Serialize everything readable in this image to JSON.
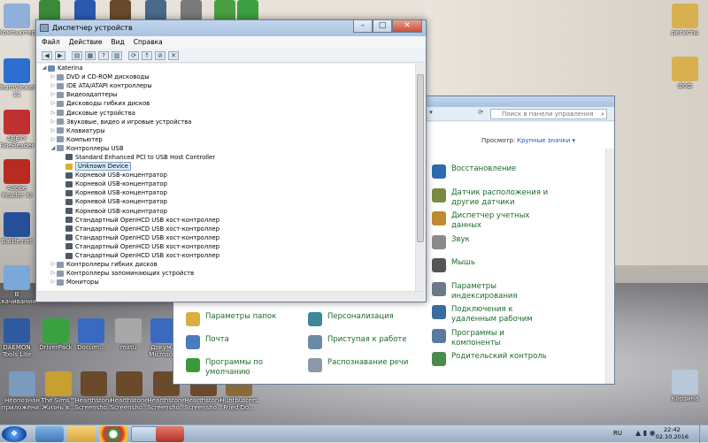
{
  "desktop": {
    "left_icons": [
      {
        "label": "Компьютер"
      },
      {
        "label": "TeamViewer 11"
      },
      {
        "label": "ABBYY FineReader"
      },
      {
        "label": "Adobe Reader XI"
      },
      {
        "label": "Battle.net"
      },
      {
        "label": "В скачивания"
      },
      {
        "label": "DAEMON Tools Lite"
      },
      {
        "label": "DriverPack"
      },
      {
        "label": "Docum..."
      },
      {
        "label": "matu"
      },
      {
        "label": "Докум... Microso..."
      }
    ],
    "bottom_icons": [
      {
        "label": "Неопознан приложени..."
      },
      {
        "label": "The Sims™ Жизнь в..."
      },
      {
        "label": "Hearthstone Screensho..."
      },
      {
        "label": "Hearthstone Screensho..."
      },
      {
        "label": "Hearthstone Screensho..."
      },
      {
        "label": "Hearthstone Screensho..."
      },
      {
        "label": "Huntbusters Fried Do..."
      }
    ],
    "right_icons": [
      {
        "label": "регисты"
      },
      {
        "label": "фоф"
      },
      {
        "label": "Корзина"
      }
    ],
    "top_icons": [
      {
        "label": ""
      },
      {
        "label": ""
      },
      {
        "label": ""
      },
      {
        "label": ""
      },
      {
        "label": ""
      },
      {
        "label": ""
      },
      {
        "label": ""
      }
    ]
  },
  "device_manager": {
    "title": "Диспетчер устройств",
    "menu": [
      "Файл",
      "Действие",
      "Вид",
      "Справка"
    ],
    "tree": [
      {
        "label": "Katerina",
        "level": 0,
        "exp": "◢"
      },
      {
        "label": "DVD и CD-ROM дисководы",
        "level": 1,
        "exp": "▷"
      },
      {
        "label": "IDE ATA/ATAPI контроллеры",
        "level": 1,
        "exp": "▷"
      },
      {
        "label": "Видеоадаптеры",
        "level": 1,
        "exp": "▷"
      },
      {
        "label": "Дисководы гибких дисков",
        "level": 1,
        "exp": "▷"
      },
      {
        "label": "Дисковые устройства",
        "level": 1,
        "exp": "▷"
      },
      {
        "label": "Звуковые, видео и игровые устройства",
        "level": 1,
        "exp": "▷"
      },
      {
        "label": "Клавиатуры",
        "level": 1,
        "exp": "▷"
      },
      {
        "label": "Компьютер",
        "level": 1,
        "exp": "▷"
      },
      {
        "label": "Контроллеры USB",
        "level": 1,
        "exp": "◢"
      },
      {
        "label": "Standard Enhanced PCI to USB Host Controller",
        "level": 2,
        "exp": ""
      },
      {
        "label": "Unknown Device",
        "level": 2,
        "exp": "",
        "selected": true
      },
      {
        "label": "Корневой USB-концентратор",
        "level": 2,
        "exp": ""
      },
      {
        "label": "Корневой USB-концентратор",
        "level": 2,
        "exp": ""
      },
      {
        "label": "Корневой USB-концентратор",
        "level": 2,
        "exp": ""
      },
      {
        "label": "Корневой USB-концентратор",
        "level": 2,
        "exp": ""
      },
      {
        "label": "Корневой USB-концентратор",
        "level": 2,
        "exp": ""
      },
      {
        "label": "Стандартный OpenHCD USB хост-контроллер",
        "level": 2,
        "exp": ""
      },
      {
        "label": "Стандартный OpenHCD USB хост-контроллер",
        "level": 2,
        "exp": ""
      },
      {
        "label": "Стандартный OpenHCD USB хост-контроллер",
        "level": 2,
        "exp": ""
      },
      {
        "label": "Стандартный OpenHCD USB хост-контроллер",
        "level": 2,
        "exp": ""
      },
      {
        "label": "Стандартный OpenHCD USB хост-контроллер",
        "level": 2,
        "exp": ""
      },
      {
        "label": "Контроллеры гибких дисков",
        "level": 1,
        "exp": "▷"
      },
      {
        "label": "Контроллеры запоминающих устройств",
        "level": 1,
        "exp": "▷"
      },
      {
        "label": "Мониторы",
        "level": 1,
        "exp": "▷"
      }
    ]
  },
  "control_panel": {
    "search_placeholder": "Поиск в панели управления",
    "view_label": "Просмотр:",
    "view_value": "Крупные значки",
    "right_items": [
      {
        "label": "Восстановление",
        "color": "#2f6ab0"
      },
      {
        "label": "Датчик расположения и другие датчики",
        "color": "#7a8a40"
      },
      {
        "label": "Диспетчер учетных данных",
        "color": "#c08a30"
      },
      {
        "label": "Звук",
        "color": "#8a8a8a"
      },
      {
        "label": "Мышь",
        "color": "#555555"
      },
      {
        "label": "Параметры индексирования",
        "color": "#6a7a8a"
      },
      {
        "label": "Подключения к удаленным рабочим",
        "color": "#3a6aa0"
      },
      {
        "label": "Программы и компоненты",
        "color": "#5a7aa0"
      },
      {
        "label": "Родительский контроль",
        "color": "#4a8a4a"
      }
    ],
    "bottom_left_items": [
      {
        "label": "Параметры папок",
        "color": "#d9b040"
      },
      {
        "label": "Почта",
        "color": "#4a7ac0"
      },
      {
        "label": "Программы по умолчанию",
        "color": "#3a9a3a"
      }
    ],
    "bottom_mid_items": [
      {
        "label": "Персонализация",
        "color": "#3a8a9a"
      },
      {
        "label": "Приступая к работе",
        "color": "#6a8aa8"
      },
      {
        "label": "Распознавание речи",
        "color": "#8a9aaa"
      }
    ]
  },
  "taskbar": {
    "lang": "RU",
    "time": "22:42",
    "date": "02.10.2016"
  }
}
